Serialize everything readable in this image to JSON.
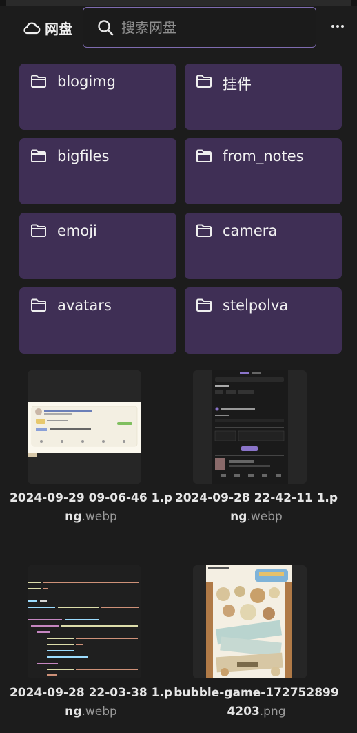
{
  "header": {
    "brand_label": "网盘",
    "search_placeholder": "搜索网盘"
  },
  "folders": [
    {
      "name": "blogimg"
    },
    {
      "name": "挂件"
    },
    {
      "name": "bigfiles"
    },
    {
      "name": "from_notes"
    },
    {
      "name": "emoji"
    },
    {
      "name": "camera"
    },
    {
      "name": "avatars"
    },
    {
      "name": "stelpolva"
    }
  ],
  "files": [
    {
      "name": "2024-09-29 09-06-46 1.png",
      "ext": ".webp",
      "thumb": "social-post"
    },
    {
      "name": "2024-09-28 22-42-11 1.png",
      "ext": ".webp",
      "thumb": "dark-settings"
    },
    {
      "name": "2024-09-28 22-03-38 1.png",
      "ext": ".webp",
      "thumb": "code-editor"
    },
    {
      "name": "bubble-game-1727528994203",
      "ext": ".png",
      "thumb": "game-screen"
    }
  ],
  "colors": {
    "folder_bg": "#3f2f55",
    "search_border": "#7e6bb0",
    "background": "#1c1c1c"
  }
}
